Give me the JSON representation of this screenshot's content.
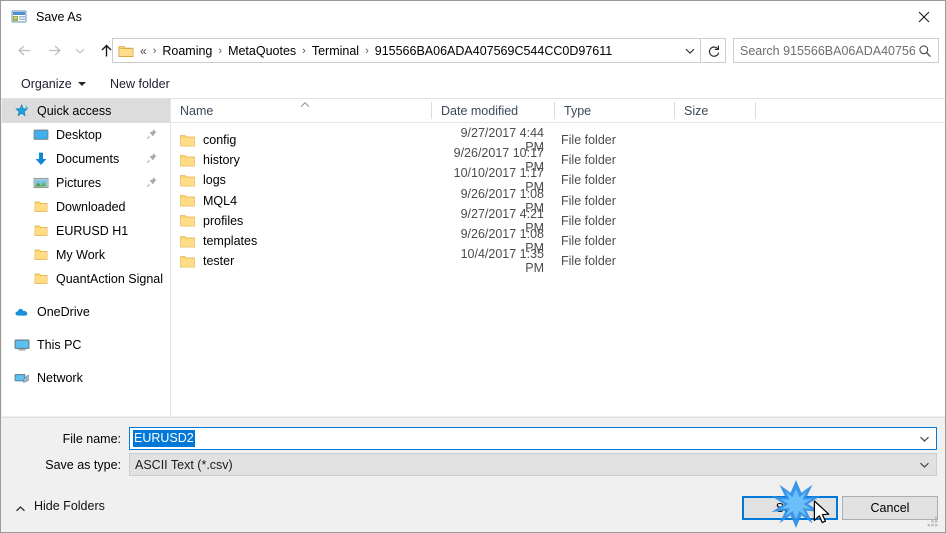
{
  "window": {
    "title": "Save As",
    "icon": "save-as-app-icon",
    "close_label": "✕"
  },
  "navigation": {
    "back": {
      "icon": "arrow-left-icon",
      "enabled": false
    },
    "forward": {
      "icon": "arrow-right-icon",
      "enabled": false
    },
    "recent": {
      "icon": "chevron-down-icon",
      "enabled": false
    },
    "up": {
      "icon": "arrow-up-icon",
      "enabled": true
    }
  },
  "address": {
    "folder_icon": "folder-icon",
    "overflow": "«",
    "separator": "›",
    "crumbs": [
      "Roaming",
      "MetaQuotes",
      "Terminal",
      "915566BA06ADA407569C544CC0D97611"
    ],
    "dropdown_icon": "chevron-down-icon",
    "refresh_icon": "refresh-icon"
  },
  "search": {
    "placeholder": "Search 915566BA06ADA40756...",
    "icon": "search-icon"
  },
  "toolbar": {
    "organize_label": "Organize",
    "new_folder_label": "New folder",
    "view_icon": "view-layout-icon",
    "help_label": "?"
  },
  "sidebar": {
    "items": [
      {
        "label": "Quick access",
        "icon": "star-pin-icon",
        "indent": "root",
        "selected": true,
        "pinned": false
      },
      {
        "label": "Desktop",
        "icon": "desktop-icon",
        "indent": "child",
        "selected": false,
        "pinned": true
      },
      {
        "label": "Documents",
        "icon": "documents-download-icon",
        "indent": "child",
        "selected": false,
        "pinned": true
      },
      {
        "label": "Pictures",
        "icon": "pictures-icon",
        "indent": "child",
        "selected": false,
        "pinned": true
      },
      {
        "label": "Downloaded",
        "icon": "folder-icon",
        "indent": "child",
        "selected": false,
        "pinned": false
      },
      {
        "label": "EURUSD H1",
        "icon": "folder-icon",
        "indent": "child",
        "selected": false,
        "pinned": false
      },
      {
        "label": "My Work",
        "icon": "folder-icon",
        "indent": "child",
        "selected": false,
        "pinned": false
      },
      {
        "label": "QuantAction Signal",
        "icon": "folder-icon",
        "indent": "child",
        "selected": false,
        "pinned": false
      }
    ],
    "roots": [
      {
        "label": "OneDrive",
        "icon": "onedrive-cloud-icon"
      },
      {
        "label": "This PC",
        "icon": "this-pc-icon"
      },
      {
        "label": "Network",
        "icon": "network-icon"
      }
    ]
  },
  "filelist": {
    "columns": [
      "Name",
      "Date modified",
      "Type",
      "Size"
    ],
    "sort_column": "Name",
    "sort_direction": "ascending",
    "rows": [
      {
        "name": "config",
        "date": "9/27/2017 4:44 PM",
        "type": "File folder",
        "size": ""
      },
      {
        "name": "history",
        "date": "9/26/2017 10:17 PM",
        "type": "File folder",
        "size": ""
      },
      {
        "name": "logs",
        "date": "10/10/2017 1:17 PM",
        "type": "File folder",
        "size": ""
      },
      {
        "name": "MQL4",
        "date": "9/26/2017 1:08 PM",
        "type": "File folder",
        "size": ""
      },
      {
        "name": "profiles",
        "date": "9/27/2017 4:21 PM",
        "type": "File folder",
        "size": ""
      },
      {
        "name": "templates",
        "date": "9/26/2017 1:08 PM",
        "type": "File folder",
        "size": ""
      },
      {
        "name": "tester",
        "date": "10/4/2017 1:35 PM",
        "type": "File folder",
        "size": ""
      }
    ]
  },
  "form": {
    "filename_label": "File name:",
    "filename_value": "EURUSD2",
    "filetype_label": "Save as type:",
    "filetype_value": "ASCII Text (*.csv)",
    "chevron_icon": "chevron-down-icon"
  },
  "footer": {
    "hide_folders_label": "Hide Folders",
    "hide_folders_icon": "chevron-up-icon",
    "save_label": "Save",
    "cancel_label": "Cancel",
    "resize_grip_icon": "resize-grip-icon"
  },
  "overlay": {
    "click_burst_icon": "click-burst-icon",
    "cursor_icon": "mouse-cursor-icon",
    "accent_color": "#0078d7",
    "burst_color": "#1e90ff"
  }
}
